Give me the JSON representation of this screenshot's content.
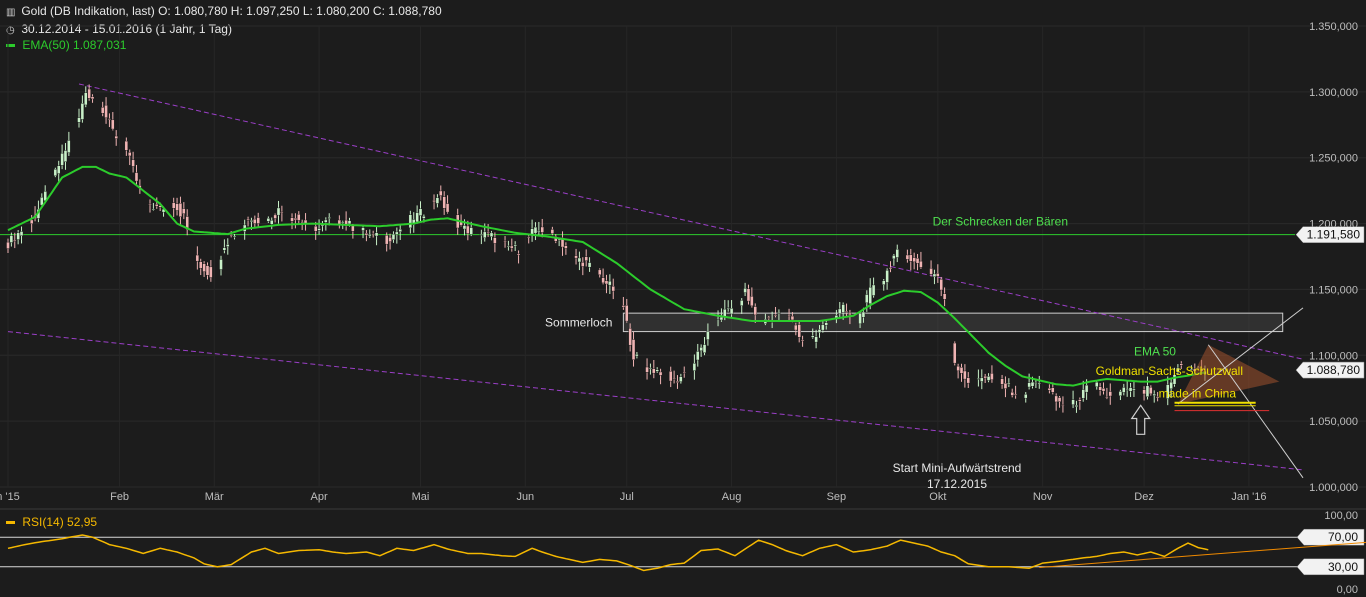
{
  "header": {
    "title_line": "Gold (DB Indikation, last)  O: 1.080,780  H: 1.097,250  L: 1.080,200  C: 1.088,780",
    "period_line": "30.12.2014 - 15.01.2016 (1 Jahr, 1 Tag)",
    "ema_label": "EMA(50)  1.087,031",
    "rsi_label": "RSI(14)  52,95"
  },
  "colors": {
    "background": "#1c1c1c",
    "candle_up": "#c8f0c8",
    "candle_down": "#f0b4b4",
    "ema": "#2ccc2c",
    "trend_channel": "#9b3fc8",
    "rsi": "#f5b800",
    "resistance_line": "#2ccc2c"
  },
  "chart_data": [
    {
      "type": "candlestick",
      "series_name": "Gold (DB Indikation, last)",
      "ylim": [
        1000,
        1350
      ],
      "y_ticks": [
        "1.350,000",
        "1.300,000",
        "1.250,000",
        "1.200,000",
        "1.150,000",
        "1.100,000",
        "1.050,000",
        "1.000,000"
      ],
      "y_tick_values": [
        1350,
        1300,
        1250,
        1200,
        1150,
        1100,
        1050,
        1000
      ],
      "x_labels": [
        "n '15",
        "Feb",
        "Mär",
        "Apr",
        "Mai",
        "Jun",
        "Jul",
        "Aug",
        "Sep",
        "Okt",
        "Nov",
        "Dez",
        "Jan '16"
      ],
      "x_label_days": [
        0,
        33,
        61,
        92,
        122,
        153,
        183,
        214,
        245,
        275,
        306,
        336,
        367
      ],
      "x_range_days": [
        0,
        383
      ],
      "last_value_label": "1.088,780",
      "price_knots": [
        [
          0,
          1185
        ],
        [
          8,
          1205
        ],
        [
          16,
          1250
        ],
        [
          21,
          1280
        ],
        [
          23,
          1300
        ],
        [
          27,
          1292
        ],
        [
          31,
          1270
        ],
        [
          35,
          1255
        ],
        [
          39,
          1225
        ],
        [
          42,
          1215
        ],
        [
          45,
          1210
        ],
        [
          48,
          1218
        ],
        [
          52,
          1205
        ],
        [
          55,
          1175
        ],
        [
          58,
          1165
        ],
        [
          61,
          1160
        ],
        [
          64,
          1185
        ],
        [
          68,
          1195
        ],
        [
          72,
          1205
        ],
        [
          76,
          1200
        ],
        [
          80,
          1210
        ],
        [
          84,
          1205
        ],
        [
          88,
          1200
        ],
        [
          92,
          1196
        ],
        [
          96,
          1205
        ],
        [
          100,
          1200
        ],
        [
          104,
          1195
        ],
        [
          108,
          1190
        ],
        [
          112,
          1188
        ],
        [
          116,
          1196
        ],
        [
          120,
          1205
        ],
        [
          124,
          1210
        ],
        [
          127,
          1222
        ],
        [
          131,
          1205
        ],
        [
          135,
          1196
        ],
        [
          139,
          1193
        ],
        [
          143,
          1190
        ],
        [
          147,
          1183
        ],
        [
          151,
          1180
        ],
        [
          155,
          1193
        ],
        [
          159,
          1196
        ],
        [
          163,
          1188
        ],
        [
          167,
          1175
        ],
        [
          171,
          1170
        ],
        [
          175,
          1160
        ],
        [
          179,
          1150
        ],
        [
          182,
          1135
        ],
        [
          185,
          1100
        ],
        [
          189,
          1090
        ],
        [
          193,
          1088
        ],
        [
          197,
          1080
        ],
        [
          202,
          1090
        ],
        [
          206,
          1110
        ],
        [
          210,
          1130
        ],
        [
          214,
          1135
        ],
        [
          218,
          1148
        ],
        [
          222,
          1125
        ],
        [
          226,
          1130
        ],
        [
          231,
          1130
        ],
        [
          235,
          1110
        ],
        [
          239,
          1115
        ],
        [
          243,
          1128
        ],
        [
          247,
          1135
        ],
        [
          251,
          1125
        ],
        [
          255,
          1148
        ],
        [
          259,
          1158
        ],
        [
          262,
          1175
        ],
        [
          265,
          1180
        ],
        [
          268,
          1170
        ],
        [
          272,
          1165
        ],
        [
          275,
          1160
        ],
        [
          278,
          1130
        ],
        [
          280,
          1095
        ],
        [
          284,
          1080
        ],
        [
          288,
          1085
        ],
        [
          292,
          1080
        ],
        [
          296,
          1075
        ],
        [
          300,
          1068
        ],
        [
          303,
          1080
        ],
        [
          307,
          1075
        ],
        [
          310,
          1065
        ],
        [
          314,
          1060
        ],
        [
          317,
          1068
        ],
        [
          321,
          1080
        ],
        [
          324,
          1072
        ],
        [
          327,
          1065
        ],
        [
          331,
          1075
        ],
        [
          334,
          1070
        ],
        [
          337,
          1073
        ],
        [
          341,
          1062
        ],
        [
          343,
          1075
        ],
        [
          347,
          1095
        ],
        [
          350,
          1088
        ],
        [
          354,
          1089
        ]
      ],
      "ema_knots": [
        [
          0,
          1195
        ],
        [
          8,
          1205
        ],
        [
          16,
          1235
        ],
        [
          22,
          1243
        ],
        [
          26,
          1243
        ],
        [
          30,
          1238
        ],
        [
          35,
          1235
        ],
        [
          40,
          1225
        ],
        [
          45,
          1215
        ],
        [
          50,
          1200
        ],
        [
          55,
          1194
        ],
        [
          60,
          1193
        ],
        [
          65,
          1192
        ],
        [
          70,
          1196
        ],
        [
          80,
          1199
        ],
        [
          90,
          1200
        ],
        [
          100,
          1199
        ],
        [
          110,
          1198
        ],
        [
          120,
          1200
        ],
        [
          125,
          1203
        ],
        [
          130,
          1204
        ],
        [
          140,
          1198
        ],
        [
          150,
          1193
        ],
        [
          160,
          1190
        ],
        [
          170,
          1186
        ],
        [
          180,
          1170
        ],
        [
          190,
          1150
        ],
        [
          200,
          1135
        ],
        [
          210,
          1130
        ],
        [
          220,
          1126
        ],
        [
          230,
          1126
        ],
        [
          240,
          1126
        ],
        [
          250,
          1130
        ],
        [
          255,
          1138
        ],
        [
          260,
          1145
        ],
        [
          265,
          1149
        ],
        [
          270,
          1148
        ],
        [
          275,
          1140
        ],
        [
          280,
          1128
        ],
        [
          285,
          1115
        ],
        [
          290,
          1102
        ],
        [
          295,
          1092
        ],
        [
          300,
          1084
        ],
        [
          310,
          1078
        ],
        [
          315,
          1077
        ],
        [
          320,
          1080
        ],
        [
          325,
          1082
        ],
        [
          330,
          1081
        ],
        [
          335,
          1080
        ],
        [
          340,
          1080
        ],
        [
          345,
          1083
        ],
        [
          350,
          1085
        ],
        [
          354,
          1087
        ]
      ],
      "resistance": {
        "value": 1191.58,
        "label": "Der Schrecken der Bären",
        "value_label": "1.191,580"
      },
      "sommerloch": {
        "label": "Sommerloch",
        "top": 1132,
        "bottom": 1118,
        "start_day": 182,
        "end_day": 377
      },
      "channel_upper": [
        [
          21,
          1306
        ],
        [
          383,
          1097
        ]
      ],
      "channel_lower": [
        [
          0,
          1118
        ],
        [
          383,
          1013
        ]
      ],
      "ema_annotation": "EMA 50",
      "triangle": {
        "apex": [
          355,
          1108
        ],
        "lower": [
          346,
          1063
        ],
        "tip": [
          376,
          1080
        ]
      },
      "gs_label_1": "Goldman-Sachs-Schutzwall",
      "gs_label_2": "made in China",
      "gs_support": 1064,
      "red_support": 1058,
      "white_up": [
        [
          346,
          1063
        ],
        [
          383,
          1136
        ]
      ],
      "white_down": [
        [
          355,
          1108
        ],
        [
          383,
          1007
        ]
      ],
      "annotation_line1": "Start Mini-Aufwärtstrend",
      "annotation_line2": "17.12.2015",
      "arrow_day": 335
    },
    {
      "type": "line",
      "series_name": "RSI(14)",
      "ylim": [
        0,
        100
      ],
      "y_ticks": [
        "100,00",
        "70,00",
        "30,00",
        "0,00"
      ],
      "y_tick_values": [
        100,
        70,
        30,
        0
      ],
      "boxed_levels": [
        70,
        30
      ],
      "rsi_knots": [
        [
          0,
          55
        ],
        [
          5,
          60
        ],
        [
          10,
          64
        ],
        [
          16,
          68
        ],
        [
          22,
          73
        ],
        [
          25,
          70
        ],
        [
          30,
          60
        ],
        [
          35,
          55
        ],
        [
          40,
          48
        ],
        [
          45,
          55
        ],
        [
          50,
          50
        ],
        [
          55,
          42
        ],
        [
          58,
          34
        ],
        [
          62,
          30
        ],
        [
          66,
          33
        ],
        [
          72,
          50
        ],
        [
          76,
          55
        ],
        [
          80,
          48
        ],
        [
          86,
          52
        ],
        [
          92,
          53
        ],
        [
          96,
          50
        ],
        [
          100,
          48
        ],
        [
          106,
          50
        ],
        [
          110,
          45
        ],
        [
          115,
          55
        ],
        [
          120,
          52
        ],
        [
          126,
          60
        ],
        [
          130,
          54
        ],
        [
          136,
          48
        ],
        [
          140,
          48
        ],
        [
          146,
          45
        ],
        [
          150,
          44
        ],
        [
          155,
          55
        ],
        [
          158,
          50
        ],
        [
          162,
          44
        ],
        [
          166,
          40
        ],
        [
          170,
          36
        ],
        [
          175,
          40
        ],
        [
          180,
          38
        ],
        [
          184,
          32
        ],
        [
          188,
          25
        ],
        [
          192,
          28
        ],
        [
          196,
          33
        ],
        [
          200,
          35
        ],
        [
          205,
          52
        ],
        [
          210,
          54
        ],
        [
          215,
          45
        ],
        [
          222,
          66
        ],
        [
          226,
          60
        ],
        [
          230,
          52
        ],
        [
          235,
          45
        ],
        [
          240,
          55
        ],
        [
          245,
          60
        ],
        [
          250,
          50
        ],
        [
          255,
          53
        ],
        [
          260,
          58
        ],
        [
          264,
          66
        ],
        [
          268,
          62
        ],
        [
          272,
          58
        ],
        [
          276,
          50
        ],
        [
          280,
          45
        ],
        [
          284,
          34
        ],
        [
          290,
          30
        ],
        [
          296,
          30
        ],
        [
          302,
          28
        ],
        [
          306,
          35
        ],
        [
          310,
          37
        ],
        [
          315,
          40
        ],
        [
          318,
          42
        ],
        [
          322,
          44
        ],
        [
          326,
          48
        ],
        [
          330,
          50
        ],
        [
          334,
          46
        ],
        [
          338,
          50
        ],
        [
          342,
          44
        ],
        [
          346,
          55
        ],
        [
          349,
          62
        ],
        [
          352,
          56
        ],
        [
          355,
          53
        ]
      ],
      "trendline": [
        [
          305,
          29
        ],
        [
          410,
          66
        ]
      ]
    }
  ]
}
